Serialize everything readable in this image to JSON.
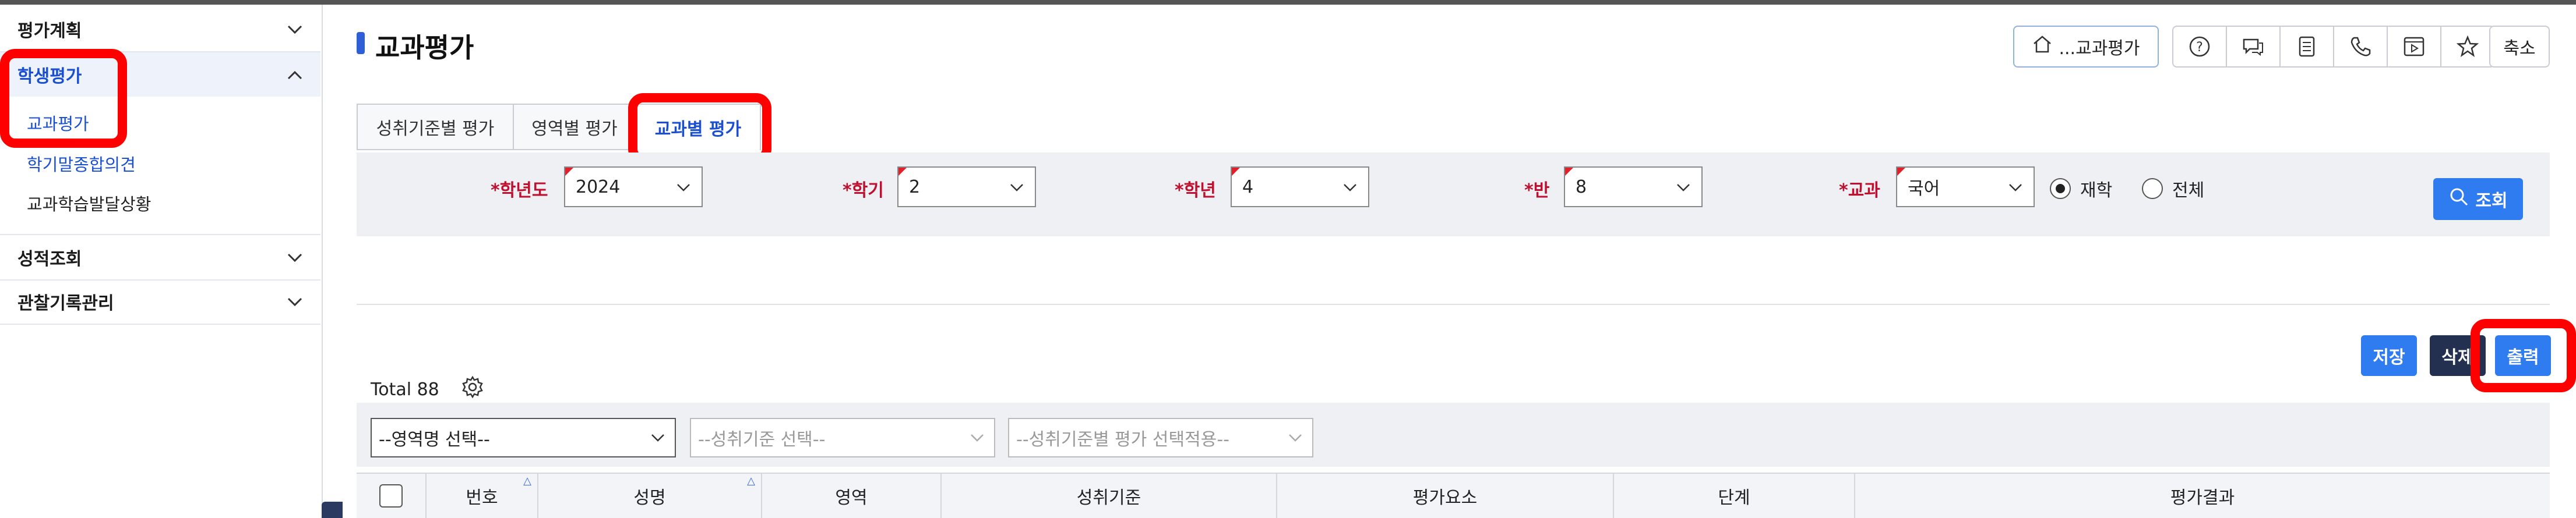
{
  "sidebar": {
    "groups": [
      {
        "label": "평가계획",
        "icon": "chevron-down-icon"
      },
      {
        "label": "학생평가",
        "icon": "chevron-up-icon",
        "active": true,
        "items": [
          "교과평가",
          "학기말종합의견",
          "교과학습발달상황"
        ]
      },
      {
        "label": "성적조회",
        "icon": "chevron-down-icon"
      },
      {
        "label": "관찰기록관리",
        "icon": "chevron-down-icon"
      }
    ]
  },
  "header": {
    "title": "교과평가",
    "path_label": "...교과평가",
    "path_icon": "home-icon",
    "tool_icons": [
      "help-icon",
      "chat-icon",
      "document-icon",
      "phone-icon",
      "video-icon",
      "star-icon"
    ],
    "shrink_label": "축소"
  },
  "tabs": [
    "성취기준별 평가",
    "영역별 평가",
    "교과별 평가"
  ],
  "active_tab": 2,
  "filters": {
    "year_label": "*학년도",
    "year_value": "2024",
    "term_label": "*학기",
    "term_value": "2",
    "grade_label": "*학년",
    "grade_value": "4",
    "class_label": "*반",
    "class_value": "8",
    "subject_label": "*교과",
    "subject_value": "국어",
    "radio_enrolled": "재학",
    "radio_all": "전체",
    "query_label": "조회"
  },
  "actions": {
    "save": "저장",
    "delete": "삭제",
    "print": "출력"
  },
  "list": {
    "total_label": "Total 88",
    "area_select": "--영역명 선택--",
    "standard_select": "--성취기준 선택--",
    "apply_select": "--성취기준별 평가 선택적용--",
    "columns": [
      "번호",
      "성명",
      "영역",
      "성취기준",
      "평가요소",
      "단계",
      "평가결과"
    ]
  },
  "colors": {
    "accent": "#2f7bf0",
    "highlight": "#ff0000",
    "required": "#c01030"
  }
}
